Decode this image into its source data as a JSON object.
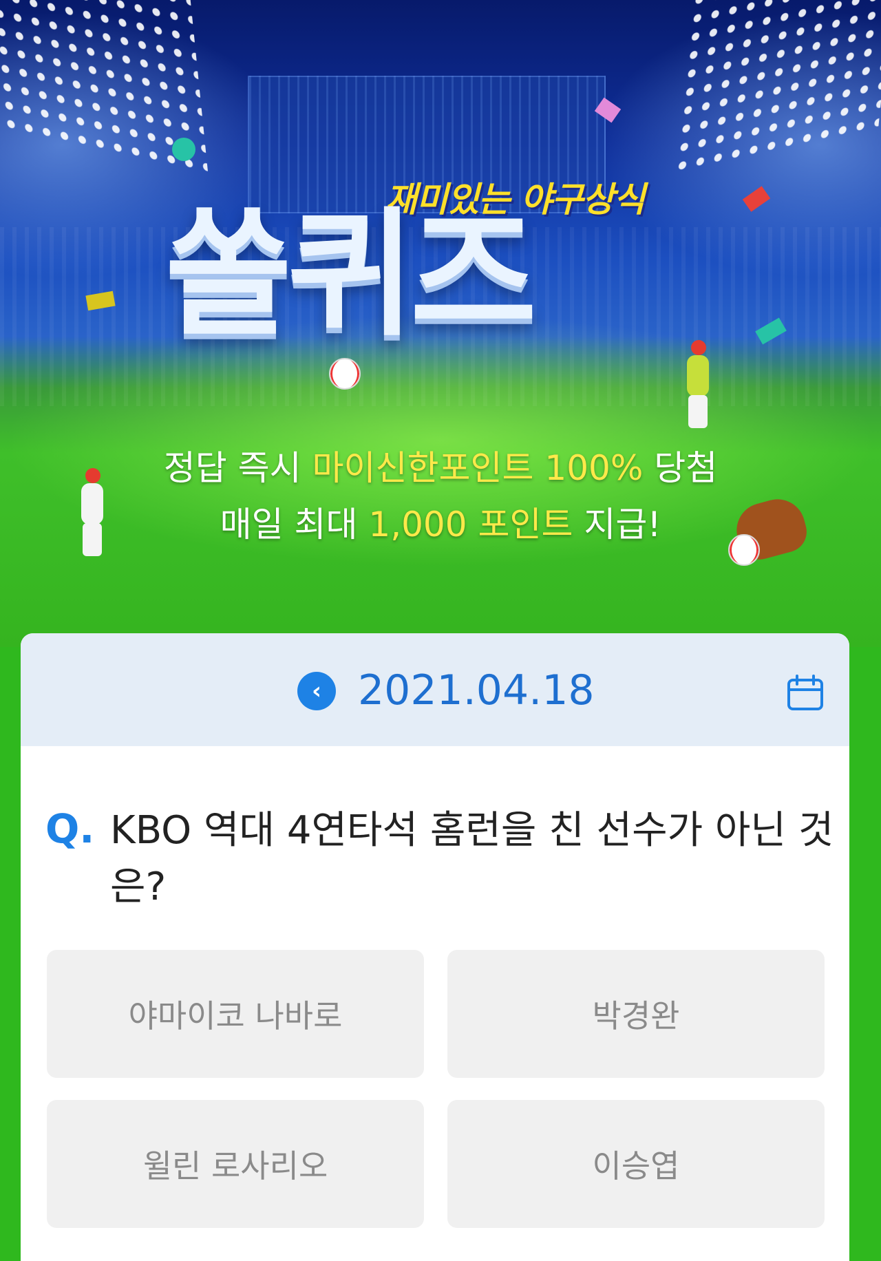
{
  "banner": {
    "subtitle": "재미있는 야구상식",
    "title": "쏠퀴즈",
    "promo_line1_pre": "정답 즉시 ",
    "promo_line1_highlight": "마이신한포인트 100%",
    "promo_line1_post": " 당첨",
    "promo_line2_pre": "매일 최대 ",
    "promo_line2_highlight": "1,000 포인트",
    "promo_line2_post": " 지급!"
  },
  "quiz": {
    "date": "2021.04.18",
    "prev_icon": "‹",
    "question_mark": "Q.",
    "question": "KBO 역대 4연타석 홈런을 친 선수가 아닌 것은?",
    "options": [
      "야마이코 나바로",
      "박경완",
      "윌린 로사리오",
      "이승엽"
    ]
  },
  "icons": {
    "prev": "chevron-left-icon",
    "calendar": "calendar-icon"
  },
  "colors": {
    "accent_blue": "#1e82e5",
    "highlight_yellow": "#ffe94a",
    "field_green": "#2fb81e"
  }
}
